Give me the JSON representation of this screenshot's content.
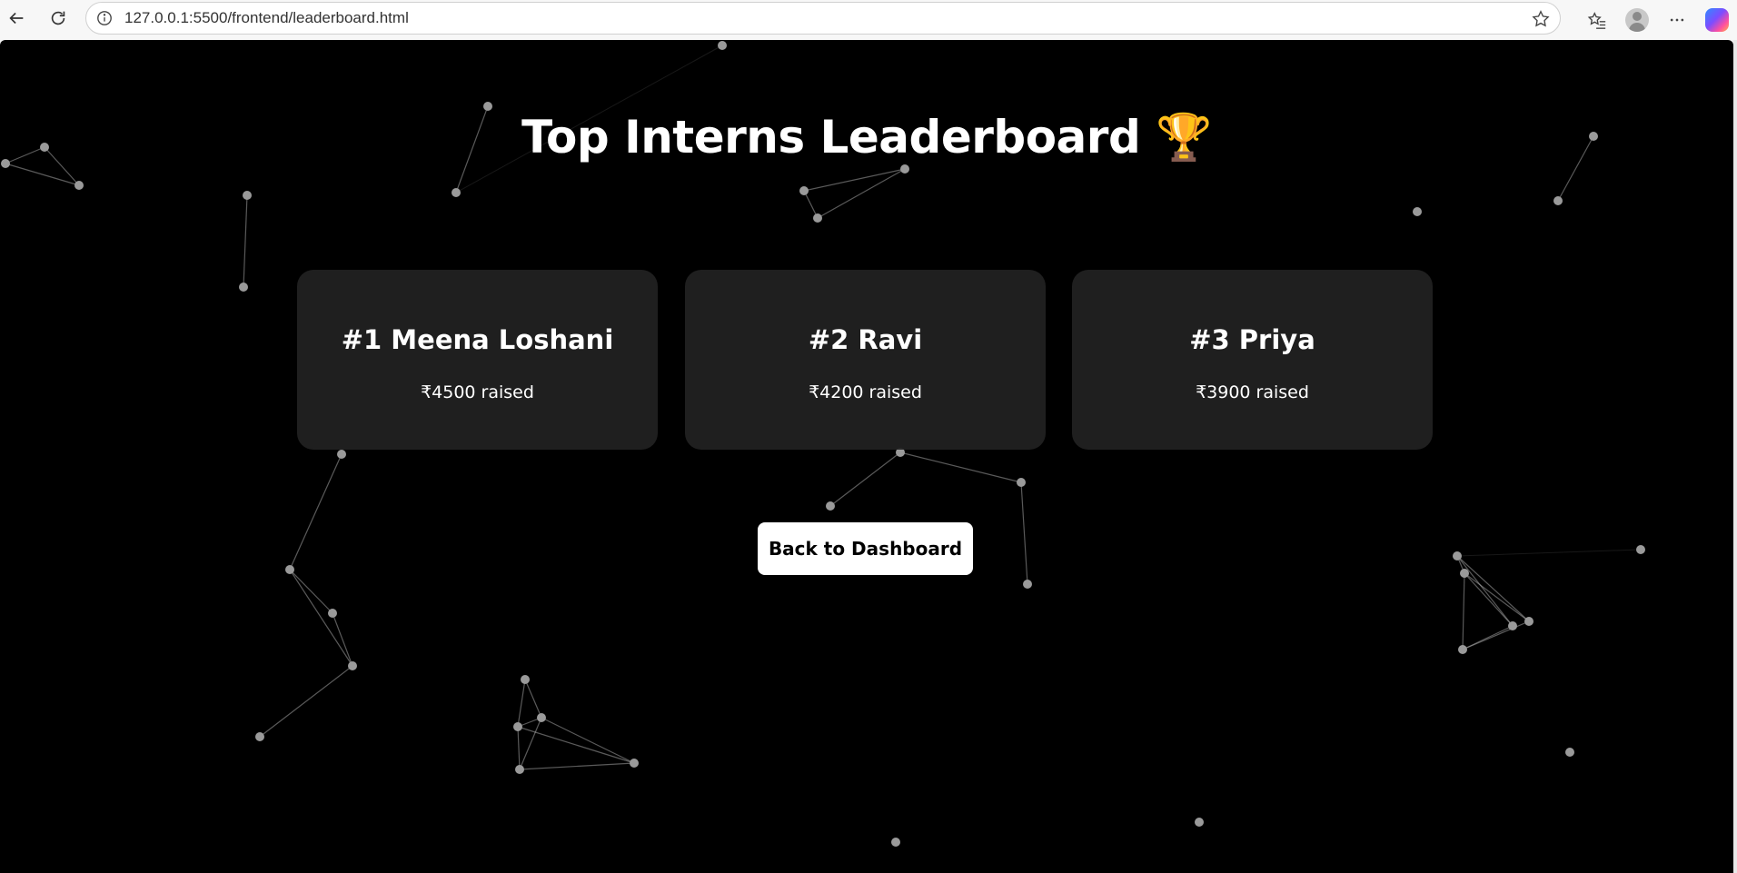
{
  "browser": {
    "url": "127.0.0.1:5500/frontend/leaderboard.html"
  },
  "page": {
    "title": "Top Interns Leaderboard 🏆",
    "back_button_label": "Back to Dashboard",
    "background_color": "#000000",
    "card_color": "#222222"
  },
  "leaderboard": [
    {
      "rank_name": "#1 Meena Loshani",
      "raised": "₹4500 raised"
    },
    {
      "rank_name": "#2 Ravi",
      "raised": "₹4200 raised"
    },
    {
      "rank_name": "#3 Priya",
      "raised": "₹3900 raised"
    }
  ],
  "icons": {
    "back": "arrow-left-icon",
    "refresh": "refresh-icon",
    "info": "info-icon",
    "favorite": "star-icon",
    "favorites_list": "favorites-icon",
    "profile": "profile-icon",
    "more": "more-icon",
    "copilot": "copilot-icon"
  }
}
